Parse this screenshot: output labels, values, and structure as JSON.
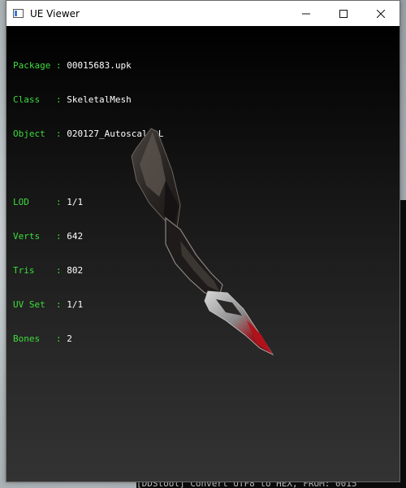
{
  "window": {
    "title": "UE Viewer",
    "controls": {
      "minimize_icon": "minimize-icon",
      "maximize_icon": "maximize-icon",
      "close_icon": "close-icon"
    }
  },
  "info": {
    "package_label": "Package",
    "package_value": "00015683.upk",
    "class_label": "Class  ",
    "class_value": "SkeletalMesh",
    "object_label": "Object ",
    "object_value": "020127_Autoscale_L",
    "lod_label": "LOD    ",
    "lod_value": "1/1",
    "verts_label": "Verts  ",
    "verts_value": "642",
    "tris_label": "Tris   ",
    "tris_value": "802",
    "uvset_label": "UV Set ",
    "uvset_value": "1/1",
    "bones_label": "Bones  ",
    "bones_value": "2",
    "separator": " : "
  },
  "background": {
    "console_line": "[DDStool] Convert UTF8 to HEX, FROM: 0015"
  },
  "colors": {
    "label_green": "#3ddc3d",
    "value_white": "#ffffff",
    "blade_red": "#b0121c"
  }
}
